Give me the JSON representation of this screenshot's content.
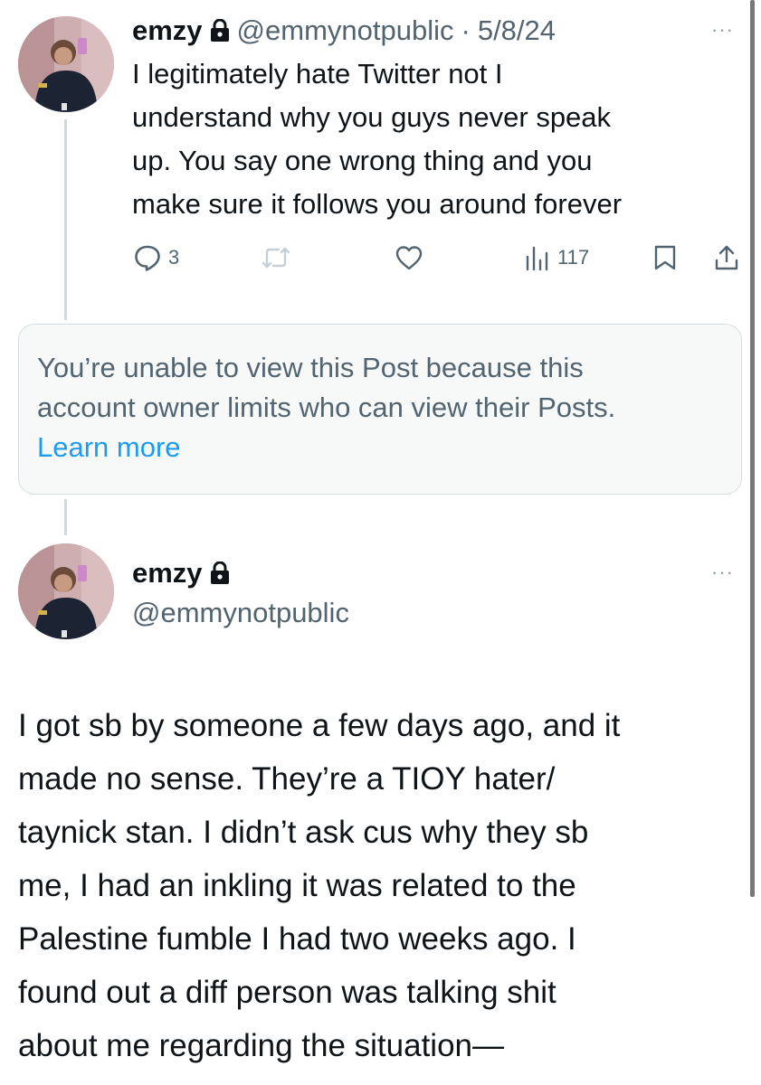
{
  "tweet1": {
    "name": "emzy",
    "handle": "@emmynotpublic",
    "separator": "·",
    "date": "5/8/24",
    "more": "···",
    "text_lines": [
      "I legitimately hate Twitter not I",
      "understand why you guys never speak",
      "up. You say one wrong thing and you",
      "make sure it follows you around forever"
    ],
    "actions": {
      "replies": "3",
      "views": "117"
    }
  },
  "notice": {
    "lines": [
      "You’re unable to view this Post because this",
      "account owner limits who can view their Posts."
    ],
    "link": "Learn more"
  },
  "tweet2": {
    "name": "emzy",
    "handle": "@emmynotpublic",
    "more": "···",
    "text_lines": [
      "I got sb by someone a few days ago, and it",
      "made no sense. They’re a TIOY hater/",
      "taynick stan. I didn’t ask cus why they sb",
      "me, I had an inkling it was related to the",
      "Palestine fumble I had two weeks ago. I",
      "found out a diff person was talking shit",
      "about me regarding the situation—"
    ]
  },
  "icons": [
    "lock-icon",
    "reply-icon",
    "retweet-icon",
    "like-icon",
    "views-icon",
    "bookmark-icon",
    "share-icon"
  ],
  "colors": {
    "text": "#0f1419",
    "secondary": "#536471",
    "link": "#1d9bf0",
    "notice_bg": "#f7f9f9"
  }
}
